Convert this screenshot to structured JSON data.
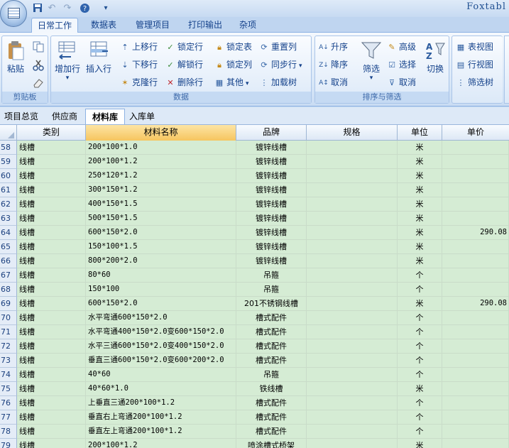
{
  "app": {
    "title": "Foxtabl"
  },
  "ribbon_tabs": [
    {
      "label": "日常工作",
      "active": true
    },
    {
      "label": "数据表"
    },
    {
      "label": "管理项目"
    },
    {
      "label": "打印输出"
    },
    {
      "label": "杂项"
    }
  ],
  "groups": {
    "clipboard": {
      "label": "剪贴板",
      "paste": "粘贴"
    },
    "data": {
      "label": "数据",
      "add_row": "增加行",
      "insert_row": "插入行",
      "move_up": "上移行",
      "move_down": "下移行",
      "clone_row": "克隆行",
      "lock_row": "锁定行",
      "unlock_row": "解锁行",
      "delete_row": "删除行",
      "lock_table": "锁定表",
      "lock_col": "锁定列",
      "other": "其他",
      "reset_col": "重置列",
      "sync_row": "同步行",
      "load_tree": "加载树"
    },
    "sort_filter": {
      "label": "排序与筛选",
      "asc": "升序",
      "desc": "降序",
      "cancel": "取消",
      "filter": "筛选",
      "advanced": "高级",
      "select": "选择",
      "cancel2": "取消",
      "switch": "切换",
      "table_view": "表视图",
      "row_view": "行视图",
      "filter_tree": "筛选树"
    }
  },
  "sheet_tabs": [
    {
      "label": "项目总览"
    },
    {
      "label": "供应商"
    },
    {
      "label": "材料库",
      "active": true
    },
    {
      "label": "入库单"
    }
  ],
  "columns": [
    "类别",
    "材料名称",
    "品牌",
    "规格",
    "单位",
    "单价"
  ],
  "active_column": "材料名称",
  "rows": [
    {
      "n": "58",
      "cat": "线槽",
      "name": "200*100*1.0",
      "brand": "镀锌线槽",
      "spec": "",
      "unit": "米",
      "price": ""
    },
    {
      "n": "59",
      "cat": "线槽",
      "name": "200*100*1.2",
      "brand": "镀锌线槽",
      "spec": "",
      "unit": "米",
      "price": ""
    },
    {
      "n": "60",
      "cat": "线槽",
      "name": "250*120*1.2",
      "brand": "镀锌线槽",
      "spec": "",
      "unit": "米",
      "price": ""
    },
    {
      "n": "61",
      "cat": "线槽",
      "name": "300*150*1.2",
      "brand": "镀锌线槽",
      "spec": "",
      "unit": "米",
      "price": ""
    },
    {
      "n": "62",
      "cat": "线槽",
      "name": "400*150*1.5",
      "brand": "镀锌线槽",
      "spec": "",
      "unit": "米",
      "price": ""
    },
    {
      "n": "63",
      "cat": "线槽",
      "name": "500*150*1.5",
      "brand": "镀锌线槽",
      "spec": "",
      "unit": "米",
      "price": ""
    },
    {
      "n": "64",
      "cat": "线槽",
      "name": "600*150*2.0",
      "brand": "镀锌线槽",
      "spec": "",
      "unit": "米",
      "price": "290.08"
    },
    {
      "n": "65",
      "cat": "线槽",
      "name": "150*100*1.5",
      "brand": "镀锌线槽",
      "spec": "",
      "unit": "米",
      "price": ""
    },
    {
      "n": "66",
      "cat": "线槽",
      "name": "800*200*2.0",
      "brand": "镀锌线槽",
      "spec": "",
      "unit": "米",
      "price": ""
    },
    {
      "n": "67",
      "cat": "线槽",
      "name": "80*60",
      "brand": "吊箍",
      "spec": "",
      "unit": "个",
      "price": ""
    },
    {
      "n": "68",
      "cat": "线槽",
      "name": "150*100",
      "brand": "吊箍",
      "spec": "",
      "unit": "个",
      "price": ""
    },
    {
      "n": "69",
      "cat": "线槽",
      "name": "600*150*2.0",
      "brand": "201不锈钢线槽",
      "spec": "",
      "unit": "米",
      "price": "290.08"
    },
    {
      "n": "70",
      "cat": "线槽",
      "name": "水平弯通600*150*2.0",
      "brand": "槽式配件",
      "spec": "",
      "unit": "个",
      "price": ""
    },
    {
      "n": "71",
      "cat": "线槽",
      "name": "水平弯通400*150*2.0变600*150*2.0",
      "brand": "槽式配件",
      "spec": "",
      "unit": "个",
      "price": ""
    },
    {
      "n": "72",
      "cat": "线槽",
      "name": "水平三通600*150*2.0变400*150*2.0",
      "brand": "槽式配件",
      "spec": "",
      "unit": "个",
      "price": ""
    },
    {
      "n": "73",
      "cat": "线槽",
      "name": "垂直三通600*150*2.0变600*200*2.0",
      "brand": "槽式配件",
      "spec": "",
      "unit": "个",
      "price": ""
    },
    {
      "n": "74",
      "cat": "线槽",
      "name": "40*60",
      "brand": "吊箍",
      "spec": "",
      "unit": "个",
      "price": ""
    },
    {
      "n": "75",
      "cat": "线槽",
      "name": "40*60*1.0",
      "brand": "铁线槽",
      "spec": "",
      "unit": "米",
      "price": ""
    },
    {
      "n": "76",
      "cat": "线槽",
      "name": "上垂直三通200*100*1.2",
      "brand": "槽式配件",
      "spec": "",
      "unit": "个",
      "price": ""
    },
    {
      "n": "77",
      "cat": "线槽",
      "name": "垂直右上弯通200*100*1.2",
      "brand": "槽式配件",
      "spec": "",
      "unit": "个",
      "price": ""
    },
    {
      "n": "78",
      "cat": "线槽",
      "name": "垂直左上弯通200*100*1.2",
      "brand": "槽式配件",
      "spec": "",
      "unit": "个",
      "price": ""
    },
    {
      "n": "79",
      "cat": "线槽",
      "name": "200*100*1.2",
      "brand": "喷涂槽式桥架",
      "spec": "",
      "unit": "米",
      "price": ""
    }
  ]
}
